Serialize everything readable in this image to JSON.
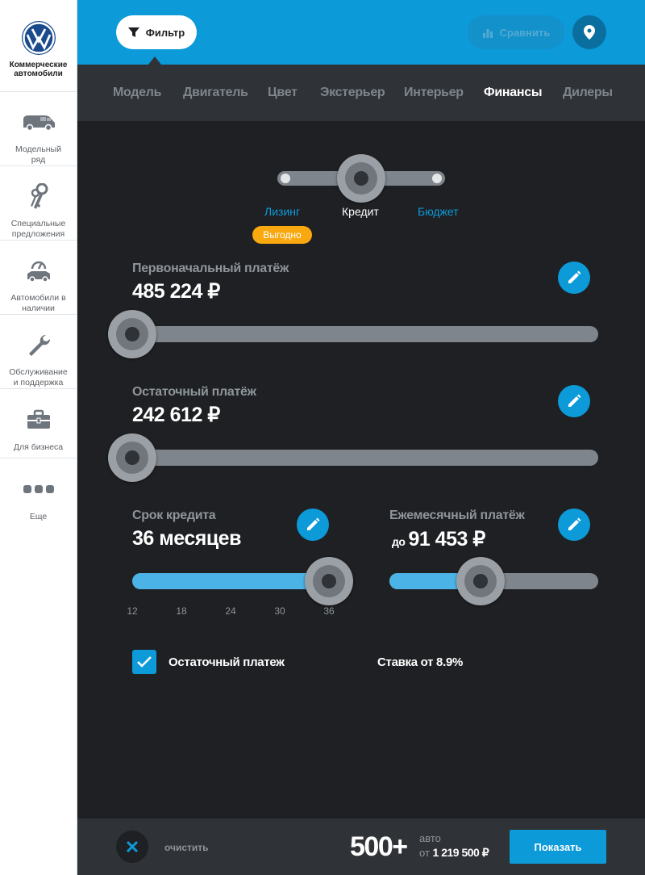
{
  "brand": {
    "name_line1": "Коммерческие",
    "name_line2": "автомобили"
  },
  "sidebar": {
    "items": [
      {
        "label_line1": "Модельный",
        "label_line2": "ряд",
        "icon": "van-icon"
      },
      {
        "label_line1": "Специальные",
        "label_line2": "предложения",
        "icon": "keys-icon"
      },
      {
        "label_line1": "Автомобили в",
        "label_line2": "наличии",
        "icon": "car-available-icon"
      },
      {
        "label_line1": "Обслуживание",
        "label_line2": "и поддержка",
        "icon": "wrench-icon"
      },
      {
        "label_line1": "Для бизнеса",
        "label_line2": "",
        "icon": "briefcase-icon"
      },
      {
        "label_line1": "Еще",
        "label_line2": "",
        "icon": "more-dots-icon"
      }
    ]
  },
  "topbar": {
    "filter_label": "Фильтр",
    "compare_label": "Сравнить",
    "accent": "#0c9ad9"
  },
  "tabs": [
    "Модель",
    "Двигатель",
    "Цвет",
    "Экстерьер",
    "Интерьер",
    "Финансы",
    "Дилеры"
  ],
  "active_tab": "Финансы",
  "finance_mode": {
    "options": [
      "Лизинг",
      "Кредит",
      "Бюджет"
    ],
    "selected": "Кредит",
    "badge": "Выгодно"
  },
  "initial_payment": {
    "label": "Первоначальный платёж",
    "value": "485 224 ₽",
    "level": 0
  },
  "residual_payment": {
    "label": "Остаточный платёж",
    "value": "242 612 ₽",
    "level": 0
  },
  "term": {
    "label": "Срок кредита",
    "value": "36 месяцев",
    "ticks": [
      "12",
      "18",
      "24",
      "30",
      "36"
    ],
    "selected_tick": "36"
  },
  "monthly": {
    "label": "Ежемесячный платёж",
    "prefix": "до",
    "value": "91 453 ₽",
    "level": 0.44
  },
  "residual_checkbox": {
    "label": "Остаточный платеж",
    "checked": true
  },
  "rate": "Ставка от 8.9%",
  "footer": {
    "clear_label": "очистить",
    "count": "500+",
    "unit": "авто",
    "price_prefix": "от",
    "price": "1 219 500 ₽",
    "show_label": "Показать"
  }
}
